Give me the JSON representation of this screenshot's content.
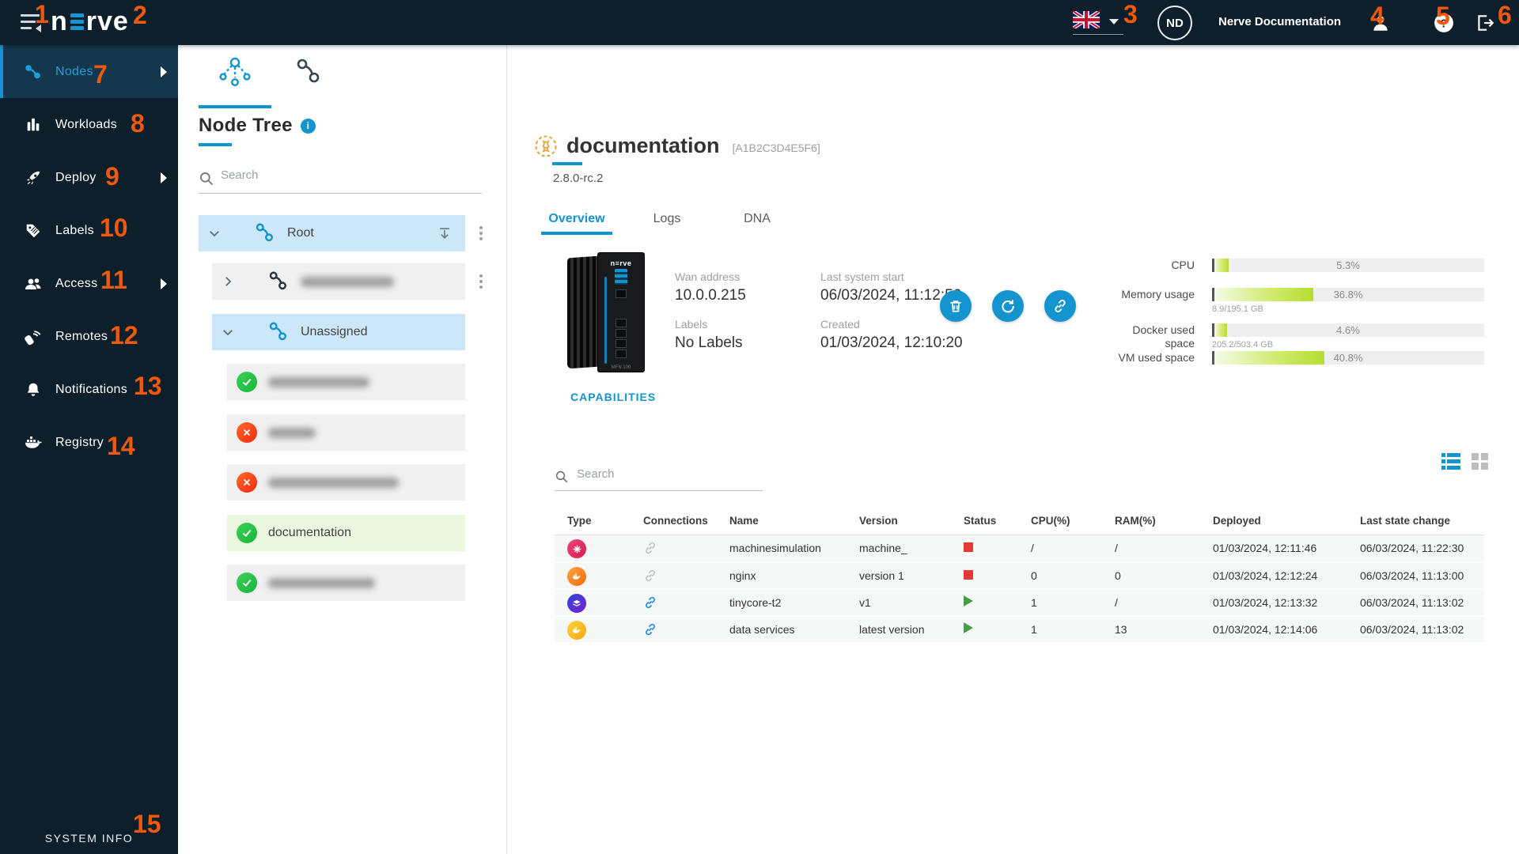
{
  "topbar": {
    "logo_prefix": "n",
    "logo_suffix": "rve",
    "language": "en-GB",
    "account_initials": "ND",
    "account_name": "Nerve Documentation",
    "icons": [
      "hamburger-icon",
      "uk-flag-icon",
      "profile-icon",
      "help-icon",
      "logout-icon"
    ]
  },
  "sidebar": {
    "items": [
      {
        "label": "Nodes",
        "icon": "nodes-icon",
        "active": true,
        "has_submenu": true
      },
      {
        "label": "Workloads",
        "icon": "workloads-icon",
        "active": false,
        "has_submenu": false
      },
      {
        "label": "Deploy",
        "icon": "deploy-rocket-icon",
        "active": false,
        "has_submenu": true
      },
      {
        "label": "Labels",
        "icon": "labels-tag-icon",
        "active": false,
        "has_submenu": false
      },
      {
        "label": "Access",
        "icon": "access-users-icon",
        "active": false,
        "has_submenu": true
      },
      {
        "label": "Remotes",
        "icon": "remotes-icon",
        "active": false,
        "has_submenu": false
      },
      {
        "label": "Notifications",
        "icon": "notifications-bell-icon",
        "active": false,
        "has_submenu": false
      },
      {
        "label": "Registry",
        "icon": "registry-docker-icon",
        "active": false,
        "has_submenu": false
      }
    ],
    "system_info_label": "SYSTEM INFO"
  },
  "tree_panel": {
    "title": "Node Tree",
    "tabs": [
      "node-tree-view-tab",
      "node-list-view-tab"
    ],
    "search_placeholder": "Search",
    "nodes": [
      {
        "label": "Root",
        "type": "group",
        "expanded": true,
        "highlighted": true,
        "blurred": false
      },
      {
        "label": "",
        "type": "group",
        "expanded": false,
        "highlighted": false,
        "blurred": true
      },
      {
        "label": "Unassigned",
        "type": "group",
        "expanded": true,
        "highlighted": true,
        "blurred": false
      },
      {
        "label": "",
        "type": "node",
        "status": "online",
        "blurred": true
      },
      {
        "label": "",
        "type": "node",
        "status": "offline",
        "blurred": true
      },
      {
        "label": "",
        "type": "node",
        "status": "offline",
        "blurred": true
      },
      {
        "label": "documentation",
        "type": "node",
        "status": "online",
        "selected": true,
        "blurred": false
      },
      {
        "label": "",
        "type": "node",
        "status": "online",
        "blurred": true
      }
    ]
  },
  "main": {
    "node": {
      "name": "documentation",
      "serial": "[A1B2C3D4E5F6]",
      "version": "2.8.0-rc.2"
    },
    "tabs": [
      "Overview",
      "Logs",
      "DNA"
    ],
    "details": [
      {
        "label": "Wan address",
        "value": "10.0.0.215"
      },
      {
        "label": "Last system start",
        "value": "06/03/2024, 11:12:56"
      },
      {
        "label": "Labels",
        "value": "No Labels"
      },
      {
        "label": "Created",
        "value": "01/03/2024, 12:10:20"
      }
    ],
    "actions": [
      "delete-node-button",
      "reboot-node-button",
      "remote-connection-button"
    ],
    "gauges": [
      {
        "label": "CPU",
        "percent": "5.3%",
        "value": 5.3,
        "sub": ""
      },
      {
        "label": "Memory usage",
        "percent": "36.8%",
        "value": 36.8,
        "sub": "8.9/195.1 GB"
      },
      {
        "label": "Docker used space",
        "percent": "4.6%",
        "value": 4.6,
        "sub": "205.2/503.4 GB"
      },
      {
        "label": "VM used space",
        "percent": "40.8%",
        "value": 40.8,
        "sub": ""
      }
    ],
    "capabilities_label": "CAPABILITIES",
    "workloads": {
      "search_placeholder": "Search",
      "view_modes": [
        "list-view-toggle",
        "grid-view-toggle"
      ],
      "columns": [
        "Type",
        "Connections",
        "Name",
        "Version",
        "Status",
        "CPU(%)",
        "RAM(%)",
        "Deployed",
        "Last state change"
      ],
      "rows": [
        {
          "type": "codesys",
          "connected": false,
          "name": "machinesimulation",
          "version": "machine_",
          "status": "stopped",
          "cpu": "/",
          "ram": "/",
          "deployed": "01/03/2024, 12:11:46",
          "last_state_change": "06/03/2024, 11:22:30"
        },
        {
          "type": "docker",
          "connected": false,
          "name": "nginx",
          "version": "version 1",
          "status": "stopped",
          "cpu": "0",
          "ram": "0",
          "deployed": "01/03/2024, 12:12:24",
          "last_state_change": "06/03/2024, 11:13:00"
        },
        {
          "type": "vm",
          "connected": true,
          "name": "tinycore-t2",
          "version": "v1",
          "status": "running",
          "cpu": "1",
          "ram": "/",
          "deployed": "01/03/2024, 12:13:32",
          "last_state_change": "06/03/2024, 11:13:02"
        },
        {
          "type": "docker-compose",
          "connected": true,
          "name": "data services",
          "version": "latest version",
          "status": "running",
          "cpu": "1",
          "ram": "13",
          "deployed": "01/03/2024, 12:14:06",
          "last_state_change": "06/03/2024, 11:13:02"
        }
      ]
    }
  },
  "annotations": {
    "items": [
      "1",
      "2",
      "3",
      "4",
      "5",
      "6",
      "7",
      "8",
      "9",
      "10",
      "11",
      "12",
      "13",
      "14",
      "15"
    ],
    "color": "#F0590C"
  }
}
